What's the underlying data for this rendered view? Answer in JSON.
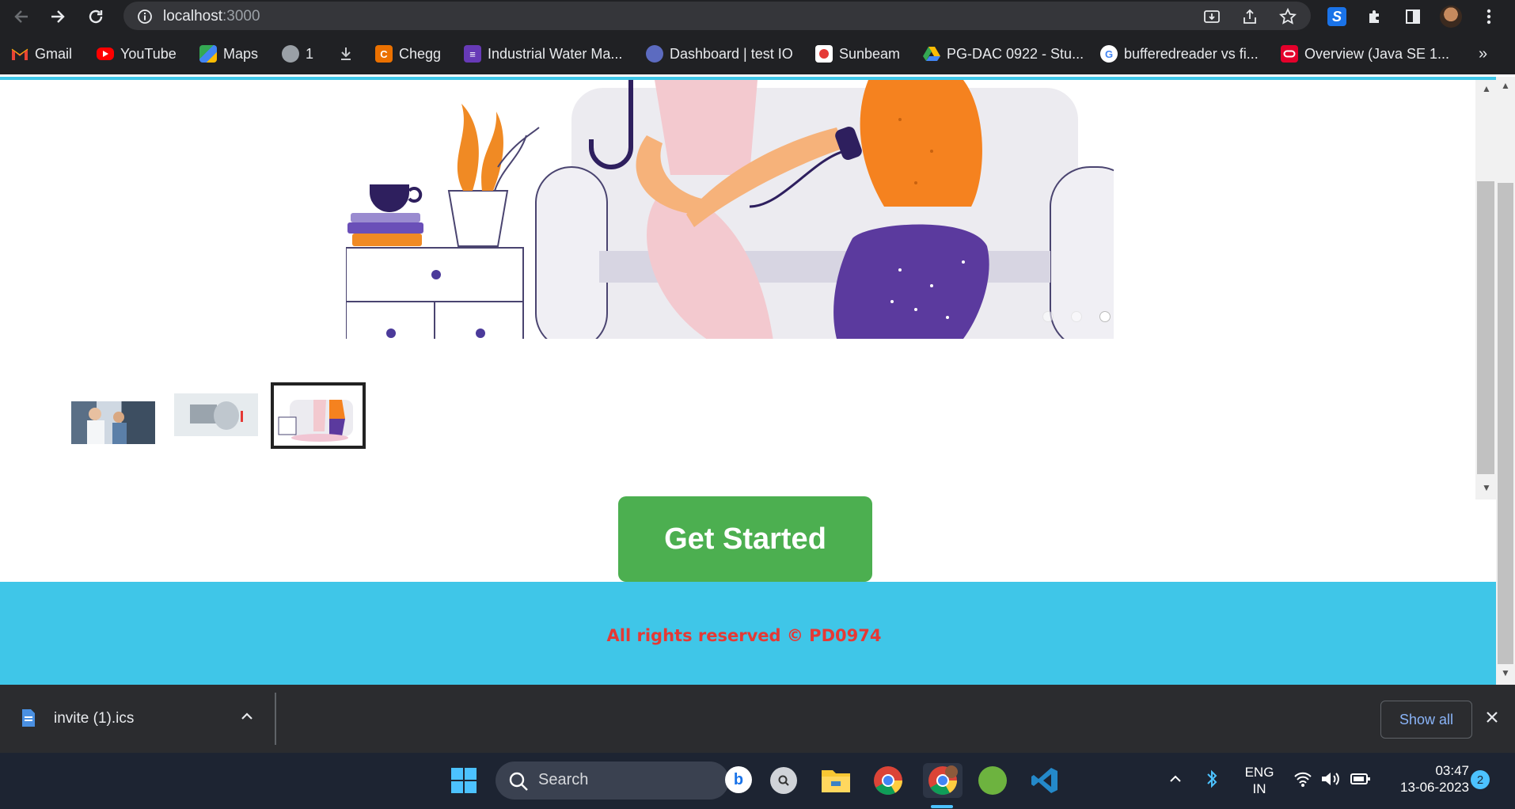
{
  "browser": {
    "url_host": "localhost",
    "url_port": ":3000"
  },
  "bookmarks": [
    {
      "label": "Gmail",
      "icon": "gmail-icon",
      "color": "#ea4335"
    },
    {
      "label": "YouTube",
      "icon": "youtube-icon",
      "color": "#ff0000"
    },
    {
      "label": "Maps",
      "icon": "maps-icon",
      "color": "#34a853"
    },
    {
      "label": "1",
      "icon": "globe-icon",
      "color": "#9aa0a6"
    },
    {
      "label": "",
      "icon": "download-icon",
      "color": "#9aa0a6"
    },
    {
      "label": "Chegg",
      "icon": "chegg-icon",
      "color": "#eb7100"
    },
    {
      "label": "Industrial Water Ma...",
      "icon": "list-icon",
      "color": "#673ab7"
    },
    {
      "label": "Dashboard | test IO",
      "icon": "testio-icon",
      "color": "#5c6bc0"
    },
    {
      "label": "Sunbeam",
      "icon": "sunbeam-icon",
      "color": "#e53935"
    },
    {
      "label": "PG-DAC 0922 - Stu...",
      "icon": "drive-icon",
      "color": "#fbbc04"
    },
    {
      "label": "bufferedreader vs fi...",
      "icon": "google-icon",
      "color": "#4285f4"
    },
    {
      "label": "Overview (Java SE 1...",
      "icon": "oracle-icon",
      "color": "#e4002b"
    }
  ],
  "page": {
    "cta_label": "Get Started",
    "footer_text": "All rights reserved © PD0974",
    "carousel_slide_count": 3,
    "carousel_active_index": 2
  },
  "downloads": {
    "file_name": "invite (1).ics",
    "show_all_label": "Show all"
  },
  "taskbar": {
    "search_label": "Search",
    "lang_top": "ENG",
    "lang_bottom": "IN",
    "time": "03:47",
    "date": "13-06-2023",
    "notification_count": "2"
  }
}
